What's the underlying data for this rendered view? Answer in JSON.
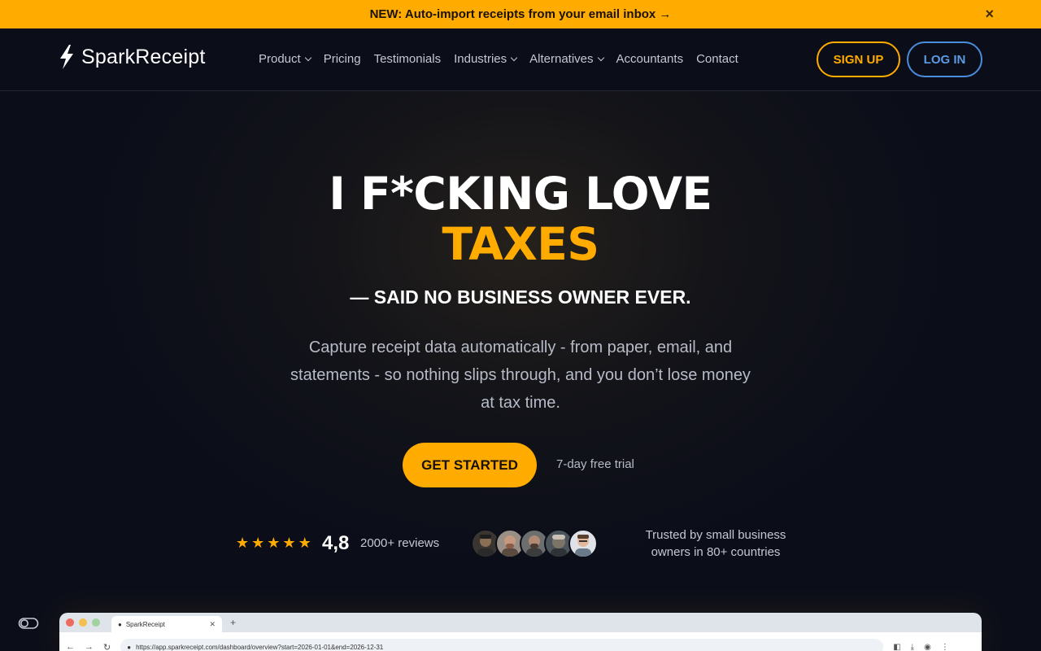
{
  "banner": {
    "text": "NEW: Auto-import receipts from your email inbox →",
    "close_label": "×"
  },
  "header": {
    "logo_text": "SparkReceipt",
    "nav": [
      {
        "label": "Product",
        "dropdown": true
      },
      {
        "label": "Pricing",
        "dropdown": false
      },
      {
        "label": "Testimonials",
        "dropdown": false
      },
      {
        "label": "Industries",
        "dropdown": true
      },
      {
        "label": "Alternatives",
        "dropdown": true
      },
      {
        "label": "Accountants",
        "dropdown": false
      },
      {
        "label": "Contact",
        "dropdown": false
      }
    ],
    "signup_label": "SIGN UP",
    "login_label": "LOG IN"
  },
  "hero": {
    "line1": "I F*CKING LOVE",
    "line2": "TAXES",
    "subtitle": "— SAID NO BUSINESS OWNER EVER.",
    "description": "Capture receipt data automatically - from paper, email, and statements - so nothing slips through, and you don’t lose money at tax time.",
    "cta_label": "GET STARTED",
    "trial_text": "7-day free trial"
  },
  "social_proof": {
    "star_count": 5,
    "rating": "4,8",
    "reviews": "2000+ reviews",
    "trusted_line1": "Trusted by small business",
    "trusted_line2": "owners in 80+ countries"
  },
  "browser_preview": {
    "tab_title": "SparkReceipt",
    "url": "https://app.sparkreceipt.com/dashboard/overview?start=2026-01-01&end=2026-12-31"
  },
  "colors": {
    "accent": "#ffab00",
    "background": "#0b0e19",
    "login_blue": "#4a8ddb"
  }
}
